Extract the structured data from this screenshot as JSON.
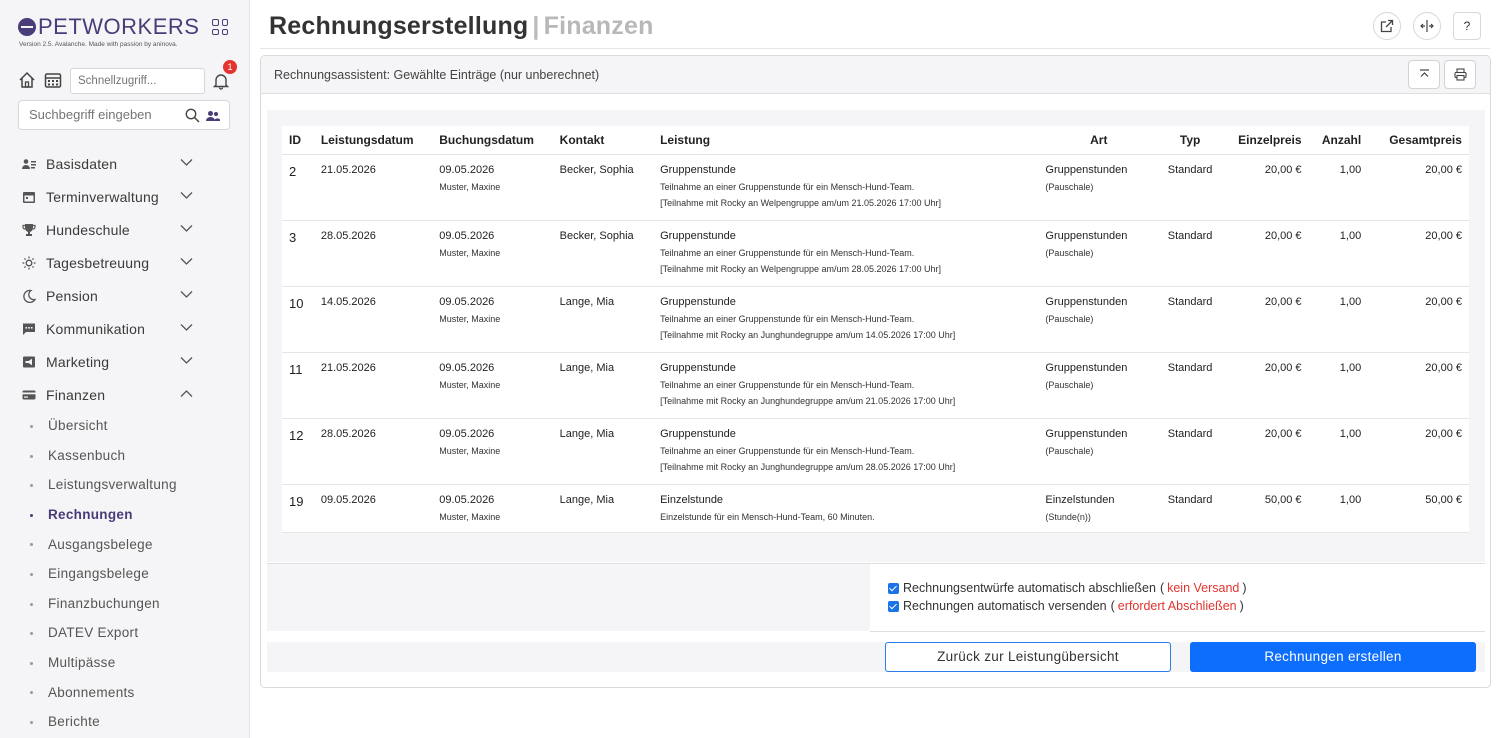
{
  "brand": {
    "name": "PETWORKERS",
    "version_text": "Version 2.5. Avalanche. Made with passion by aninova."
  },
  "quick": {
    "placeholder": "Schnellzugriff...",
    "notification_count": "1"
  },
  "search": {
    "placeholder": "Suchbegriff eingeben"
  },
  "nav": {
    "items": [
      {
        "label": "Basisdaten",
        "icon": "contacts-icon",
        "expanded": false
      },
      {
        "label": "Terminverwaltung",
        "icon": "calendar-icon",
        "expanded": false
      },
      {
        "label": "Hundeschule",
        "icon": "trophy-icon",
        "expanded": false
      },
      {
        "label": "Tagesbetreuung",
        "icon": "sun-icon",
        "expanded": false
      },
      {
        "label": "Pension",
        "icon": "moon-icon",
        "expanded": false
      },
      {
        "label": "Kommunikation",
        "icon": "chat-icon",
        "expanded": false
      },
      {
        "label": "Marketing",
        "icon": "megaphone-icon",
        "expanded": false
      },
      {
        "label": "Finanzen",
        "icon": "card-icon",
        "expanded": true
      }
    ],
    "finanzen_sub": [
      {
        "label": "Übersicht",
        "active": false
      },
      {
        "label": "Kassenbuch",
        "active": false
      },
      {
        "label": "Leistungsverwaltung",
        "active": false
      },
      {
        "label": "Rechnungen",
        "active": true
      },
      {
        "label": "Ausgangsbelege",
        "active": false
      },
      {
        "label": "Eingangsbelege",
        "active": false
      },
      {
        "label": "Finanzbuchungen",
        "active": false
      },
      {
        "label": "DATEV Export",
        "active": false
      },
      {
        "label": "Multipässe",
        "active": false
      },
      {
        "label": "Abonnements",
        "active": false
      },
      {
        "label": "Berichte",
        "active": false
      }
    ]
  },
  "header": {
    "title": "Rechnungserstellung",
    "separator": "|",
    "subtitle": "Finanzen",
    "help_label": "?"
  },
  "card": {
    "title": "Rechnungsassistent: Gewählte Einträge (nur unberechnet)"
  },
  "table": {
    "columns": [
      "ID",
      "Leistungsdatum",
      "Buchungsdatum",
      "Kontakt",
      "Leistung",
      "Art",
      "Typ",
      "Einzelpreis",
      "Anzahl",
      "Gesamtpreis"
    ],
    "rows": [
      {
        "id": "2",
        "leistungsdatum": "21.05.2026",
        "buchungsdatum": "09.05.2026",
        "bucher": "Muster, Maxine",
        "kontakt": "Becker, Sophia",
        "leistung": "Gruppenstunde",
        "beschreibung": "Teilnahme an einer Gruppenstunde für ein Mensch-Hund-Team.",
        "detail": "[Teilnahme mit Rocky an Welpengruppe am/um 21.05.2026 17:00 Uhr]",
        "art": "Gruppenstunden",
        "art_sub": "(Pauschale)",
        "typ": "Standard",
        "einzelpreis": "20,00 €",
        "anzahl": "1,00",
        "gesamtpreis": "20,00 €"
      },
      {
        "id": "3",
        "leistungsdatum": "28.05.2026",
        "buchungsdatum": "09.05.2026",
        "bucher": "Muster, Maxine",
        "kontakt": "Becker, Sophia",
        "leistung": "Gruppenstunde",
        "beschreibung": "Teilnahme an einer Gruppenstunde für ein Mensch-Hund-Team.",
        "detail": "[Teilnahme mit Rocky an Welpengruppe am/um 28.05.2026 17:00 Uhr]",
        "art": "Gruppenstunden",
        "art_sub": "(Pauschale)",
        "typ": "Standard",
        "einzelpreis": "20,00 €",
        "anzahl": "1,00",
        "gesamtpreis": "20,00 €"
      },
      {
        "id": "10",
        "leistungsdatum": "14.05.2026",
        "buchungsdatum": "09.05.2026",
        "bucher": "Muster, Maxine",
        "kontakt": "Lange, Mia",
        "leistung": "Gruppenstunde",
        "beschreibung": "Teilnahme an einer Gruppenstunde für ein Mensch-Hund-Team.",
        "detail": "[Teilnahme mit Rocky an Junghundegruppe am/um 14.05.2026 17:00 Uhr]",
        "art": "Gruppenstunden",
        "art_sub": "(Pauschale)",
        "typ": "Standard",
        "einzelpreis": "20,00 €",
        "anzahl": "1,00",
        "gesamtpreis": "20,00 €"
      },
      {
        "id": "11",
        "leistungsdatum": "21.05.2026",
        "buchungsdatum": "09.05.2026",
        "bucher": "Muster, Maxine",
        "kontakt": "Lange, Mia",
        "leistung": "Gruppenstunde",
        "beschreibung": "Teilnahme an einer Gruppenstunde für ein Mensch-Hund-Team.",
        "detail": "[Teilnahme mit Rocky an Junghundegruppe am/um 21.05.2026 17:00 Uhr]",
        "art": "Gruppenstunden",
        "art_sub": "(Pauschale)",
        "typ": "Standard",
        "einzelpreis": "20,00 €",
        "anzahl": "1,00",
        "gesamtpreis": "20,00 €"
      },
      {
        "id": "12",
        "leistungsdatum": "28.05.2026",
        "buchungsdatum": "09.05.2026",
        "bucher": "Muster, Maxine",
        "kontakt": "Lange, Mia",
        "leistung": "Gruppenstunde",
        "beschreibung": "Teilnahme an einer Gruppenstunde für ein Mensch-Hund-Team.",
        "detail": "[Teilnahme mit Rocky an Junghundegruppe am/um 28.05.2026 17:00 Uhr]",
        "art": "Gruppenstunden",
        "art_sub": "(Pauschale)",
        "typ": "Standard",
        "einzelpreis": "20,00 €",
        "anzahl": "1,00",
        "gesamtpreis": "20,00 €"
      },
      {
        "id": "19",
        "leistungsdatum": "09.05.2026",
        "buchungsdatum": "09.05.2026",
        "bucher": "Muster, Maxine",
        "kontakt": "Lange, Mia",
        "leistung": "Einzelstunde",
        "beschreibung": "Einzelstunde für ein Mensch-Hund-Team, 60 Minuten.",
        "detail": "",
        "art": "Einzelstunden",
        "art_sub": "(Stunde(n))",
        "typ": "Standard",
        "einzelpreis": "50,00 €",
        "anzahl": "1,00",
        "gesamtpreis": "50,00 €"
      }
    ]
  },
  "options": {
    "auto_close": {
      "label": "Rechnungsentwürfe automatisch abschließen",
      "note": "kein Versand",
      "checked": true
    },
    "auto_send": {
      "label": "Rechnungen automatisch versenden",
      "note": "erfordert Abschließen",
      "checked": true
    },
    "paren_open": "(",
    "paren_close": ")"
  },
  "actions": {
    "back_label": "Zurück zur Leistungübersicht",
    "create_label": "Rechnungen erstellen"
  },
  "colors": {
    "brand": "#4a3c78",
    "primary": "#0d6efd",
    "danger": "#e3342f"
  }
}
